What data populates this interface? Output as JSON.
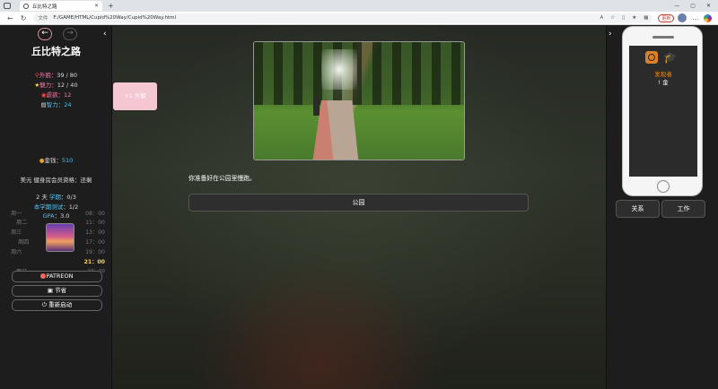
{
  "browser": {
    "tab_title": "丘比特之路",
    "url_label": "文件",
    "url": "F:/GAME/HTML/Cupid%20Way/Cupid%20Way.html",
    "update_badge": "更新"
  },
  "left": {
    "title": "丘比特之路",
    "stats": [
      {
        "label": "外貌：",
        "value": "39 / 80",
        "icon": "person-icon"
      },
      {
        "label": "魅力：",
        "value": "12 / 40",
        "icon": "star-icon"
      },
      {
        "label": "虐欲：",
        "value": "12",
        "icon": "lips-icon"
      },
      {
        "label": "智力：",
        "value": "24",
        "icon": "book-icon"
      }
    ],
    "money_label": "金钱：",
    "money_value": "510",
    "gym": "美元 健身房会员资格：还剩",
    "term": {
      "day": "2 天",
      "period_label": "学期",
      "period_value": "：0/3",
      "exam_label": "本学期测试",
      "exam_value": "：1/2",
      "gpa_label": "GPA",
      "gpa_value": "：3.0"
    },
    "schedule": [
      {
        "day": "周一",
        "time": "08：00"
      },
      {
        "day": "周二",
        "time": "11：00"
      },
      {
        "day": "周三",
        "time": "13：00"
      },
      {
        "day": "周四",
        "time": "17：00"
      },
      {
        "day": "周六",
        "time": "19：00"
      },
      {
        "day": "",
        "time": "21：00"
      },
      {
        "day": "周日",
        "time": "23：00"
      }
    ],
    "buttons": {
      "patreon": "PATREON",
      "save": "节省",
      "restart": "重新启动"
    }
  },
  "main": {
    "popup": "+1 外貌",
    "story": "你准备好在公园里慢跑。",
    "choice": "公园"
  },
  "right": {
    "phone_line1": "发现者",
    "phone_line2": "! 金",
    "btn_relations": "关系",
    "btn_work": "工作"
  }
}
